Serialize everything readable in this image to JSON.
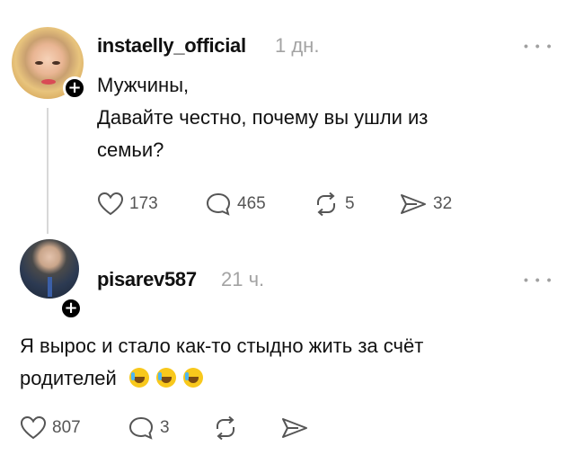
{
  "post": {
    "username": "instaelly_official",
    "time": "1 дн.",
    "more_label": "• • •",
    "lines": [
      "Мужчины,",
      "Давайте честно, почему вы ушли из",
      "семьи?"
    ],
    "likes": "173",
    "comments": "465",
    "reposts": "5",
    "shares": "32"
  },
  "reply": {
    "username": "pisarev587",
    "time": "21 ч.",
    "more_label": "• • •",
    "lines": [
      "Я вырос и стало как-то стыдно жить за счёт",
      "родителей"
    ],
    "emoji_count": 3,
    "emoji_name": "rolling-on-floor-laughing-emoji",
    "likes": "807",
    "comments": "3"
  },
  "icons": [
    "heart-icon",
    "comment-icon",
    "repost-icon",
    "share-icon",
    "plus-icon"
  ],
  "colors": {
    "text": "#101010",
    "muted": "#a3a3a3",
    "icon": "#555555",
    "emoji": "#f8c81c"
  }
}
